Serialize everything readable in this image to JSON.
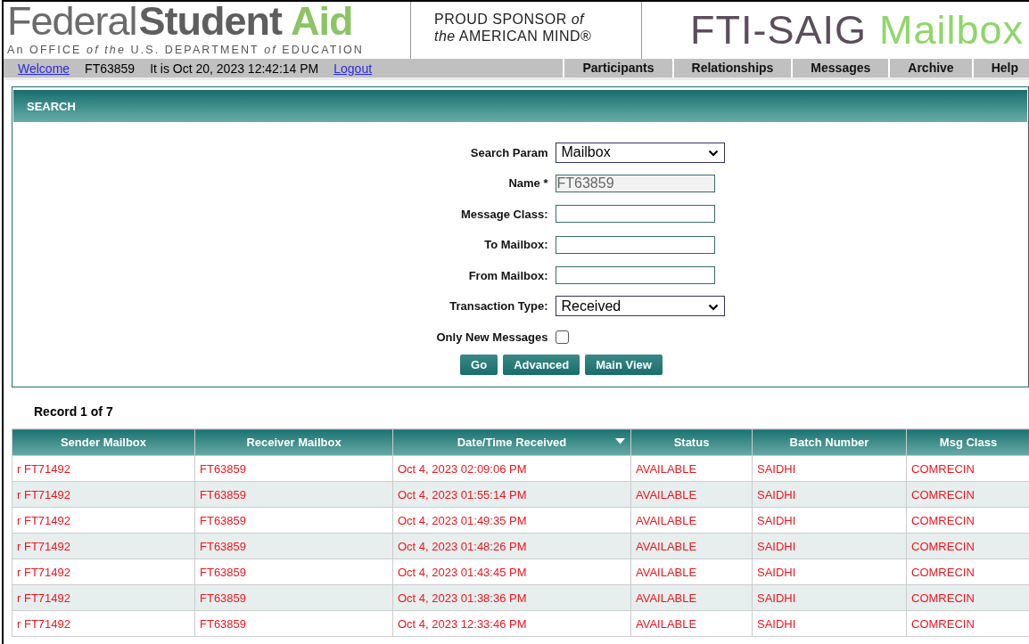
{
  "header": {
    "logo": {
      "part_1": "Federal",
      "part_2": "Student",
      "part_3": "Aid",
      "tagline": "An OFFICE *of the* U.S. DEPARTMENT *of* EDUCATION"
    },
    "sponsor": [
      "PROUD SPONSOR *of*",
      "*the* AMERICAN MIND®"
    ],
    "title": {
      "part_1": "FTI-SAIG",
      "part_2": "Mailbox"
    }
  },
  "user_bar": [
    {
      "kind": "link",
      "text": "Welcome"
    },
    {
      "kind": "text",
      "text": "FT63859"
    },
    {
      "kind": "text",
      "text": "It is Oct 20, 2023 12:42:14 PM"
    },
    {
      "kind": "link",
      "text": "Logout"
    }
  ],
  "nav": [
    {
      "label": "Participants"
    },
    {
      "label": "Relationships"
    },
    {
      "label": "Messages"
    },
    {
      "label": "Archive"
    },
    {
      "label": "Help"
    }
  ],
  "search_panel": {
    "title": "SEARCH",
    "fields": [
      {
        "label": "Search Param",
        "kind": "select",
        "value": "Mailbox"
      },
      {
        "label": "Name *",
        "kind": "text",
        "value": "FT63859",
        "disabled": true
      },
      {
        "label": "Message Class:",
        "kind": "text",
        "disabled": false
      },
      {
        "label": "To Mailbox:",
        "kind": "text",
        "disabled": false
      },
      {
        "label": "From Mailbox:",
        "kind": "text",
        "disabled": false
      },
      {
        "label": "Transaction Type:",
        "kind": "select",
        "value": "Received"
      },
      {
        "label": "Only New Messages",
        "kind": "checkbox",
        "checked": false
      }
    ],
    "buttons": [
      "Go",
      "Advanced",
      "Main View"
    ]
  },
  "record_count": "Record 1 of 7",
  "table": {
    "columns": [
      {
        "label": "Sender Mailbox",
        "sorted": false
      },
      {
        "label": "Receiver Mailbox",
        "sorted": false
      },
      {
        "label": "Date/Time Received",
        "sorted": true
      },
      {
        "label": "Status",
        "sorted": false
      },
      {
        "label": "Batch Number",
        "sorted": false
      },
      {
        "label": "Msg Class",
        "sorted": false
      }
    ],
    "rows": [
      [
        "r FT71492",
        "FT63859",
        "Oct 4, 2023 02:09:06 PM",
        "AVAILABLE",
        "SAIDHI",
        "COMRECIN"
      ],
      [
        "r FT71492",
        "FT63859",
        "Oct 4, 2023 01:55:14 PM",
        "AVAILABLE",
        "SAIDHI",
        "COMRECIN"
      ],
      [
        "r FT71492",
        "FT63859",
        "Oct 4, 2023 01:49:35 PM",
        "AVAILABLE",
        "SAIDHI",
        "COMRECIN"
      ],
      [
        "r FT71492",
        "FT63859",
        "Oct 4, 2023 01:48:26 PM",
        "AVAILABLE",
        "SAIDHI",
        "COMRECIN"
      ],
      [
        "r FT71492",
        "FT63859",
        "Oct 4, 2023 01:43:45 PM",
        "AVAILABLE",
        "SAIDHI",
        "COMRECIN"
      ],
      [
        "r FT71492",
        "FT63859",
        "Oct 4, 2023 01:38:36 PM",
        "AVAILABLE",
        "SAIDHI",
        "COMRECIN"
      ],
      [
        "r FT71492",
        "FT63859",
        "Oct 4, 2023 12:33:46 PM",
        "AVAILABLE",
        "SAIDHI",
        "COMRECIN"
      ]
    ]
  }
}
